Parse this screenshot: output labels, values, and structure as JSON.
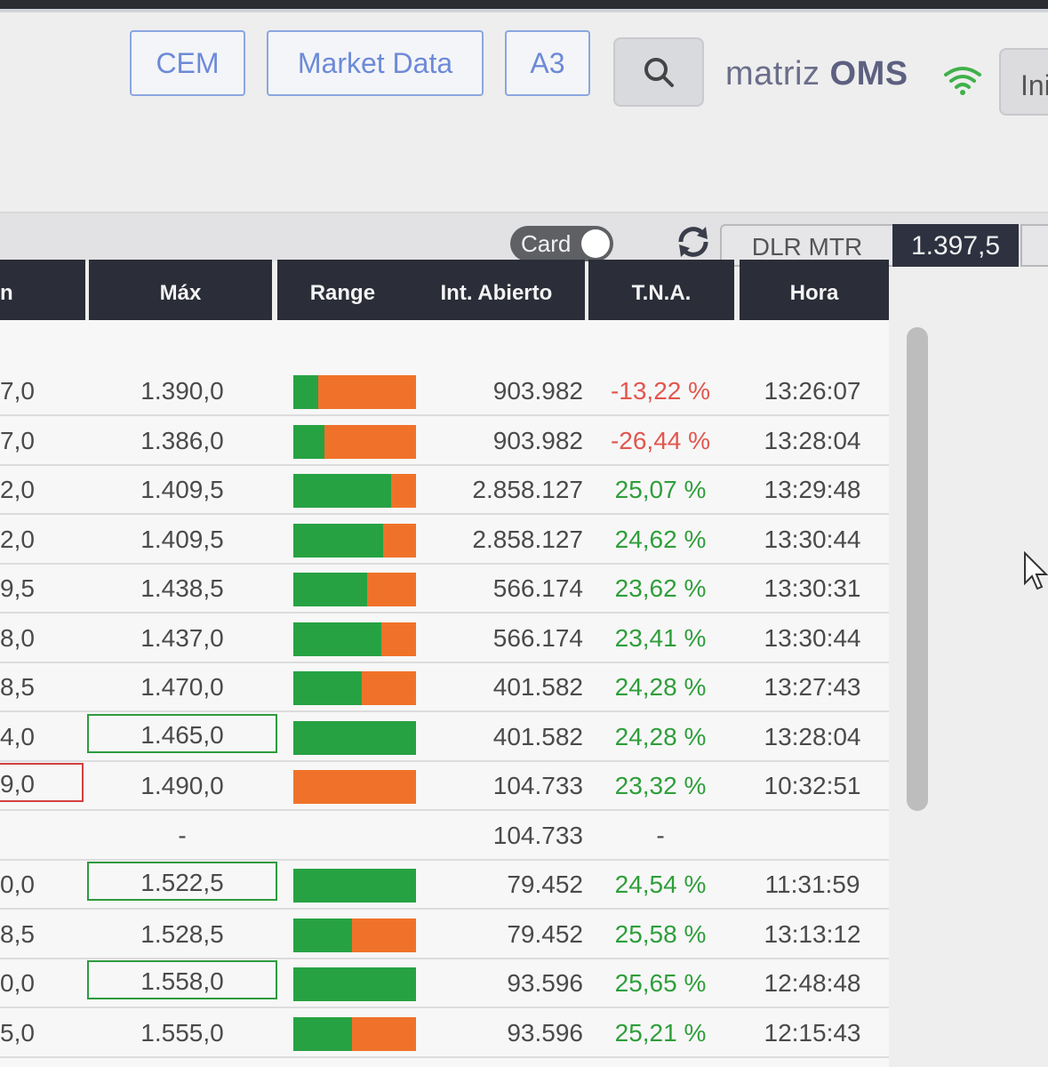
{
  "nav": {
    "cem_label": "CEM",
    "market_data_label": "Market Data",
    "a3_label": "A3",
    "search_icon": "search-icon",
    "brand_prefix": "matriz",
    "brand_suffix": "OMS",
    "wifi_icon": "wifi-icon",
    "partial_button_label": "Ini"
  },
  "toolbar": {
    "card_toggle_label": "Card",
    "refresh_icon": "refresh-icon",
    "dlr_label": "DLR MTR",
    "dlr_value": "1.397,5"
  },
  "table": {
    "headers": {
      "prev": "n",
      "max": "Máx",
      "range": "Range",
      "int_abierto": "Int. Abierto",
      "tna": "T.N.A.",
      "hora": "Hora"
    },
    "rows": [
      {
        "prev": "7,0",
        "max": "1.390,0",
        "range_green_fraction": 0.2,
        "int_abierto": "903.982",
        "tna": "-13,22 %",
        "tna_sign": "neg",
        "hora": "13:26:07",
        "highlight": ""
      },
      {
        "prev": "7,0",
        "max": "1.386,0",
        "range_green_fraction": 0.25,
        "int_abierto": "903.982",
        "tna": "-26,44 %",
        "tna_sign": "neg",
        "hora": "13:28:04",
        "highlight": ""
      },
      {
        "prev": "2,0",
        "max": "1.409,5",
        "range_green_fraction": 0.8,
        "int_abierto": "2.858.127",
        "tna": "25,07 %",
        "tna_sign": "pos",
        "hora": "13:29:48",
        "highlight": ""
      },
      {
        "prev": "2,0",
        "max": "1.409,5",
        "range_green_fraction": 0.73,
        "int_abierto": "2.858.127",
        "tna": "24,62 %",
        "tna_sign": "pos",
        "hora": "13:30:44",
        "highlight": ""
      },
      {
        "prev": "9,5",
        "max": "1.438,5",
        "range_green_fraction": 0.6,
        "int_abierto": "566.174",
        "tna": "23,62 %",
        "tna_sign": "pos",
        "hora": "13:30:31",
        "highlight": ""
      },
      {
        "prev": "8,0",
        "max": "1.437,0",
        "range_green_fraction": 0.72,
        "int_abierto": "566.174",
        "tna": "23,41 %",
        "tna_sign": "pos",
        "hora": "13:30:44",
        "highlight": ""
      },
      {
        "prev": "8,5",
        "max": "1.470,0",
        "range_green_fraction": 0.56,
        "int_abierto": "401.582",
        "tna": "24,28 %",
        "tna_sign": "pos",
        "hora": "13:27:43",
        "highlight": ""
      },
      {
        "prev": "4,0",
        "max": "1.465,0",
        "range_green_fraction": 1.0,
        "int_abierto": "401.582",
        "tna": "24,28 %",
        "tna_sign": "pos",
        "hora": "13:28:04",
        "highlight": "max-green"
      },
      {
        "prev": "9,0",
        "max": "1.490,0",
        "range_green_fraction": 0.0,
        "int_abierto": "104.733",
        "tna": "23,32 %",
        "tna_sign": "pos",
        "hora": "10:32:51",
        "highlight": "prev-red"
      },
      {
        "prev": "",
        "max": "-",
        "range_green_fraction": null,
        "int_abierto": "104.733",
        "tna": "-",
        "tna_sign": "none",
        "hora": "",
        "highlight": ""
      },
      {
        "prev": "0,0",
        "max": "1.522,5",
        "range_green_fraction": 1.0,
        "int_abierto": "79.452",
        "tna": "24,54 %",
        "tna_sign": "pos",
        "hora": "11:31:59",
        "highlight": "max-green"
      },
      {
        "prev": "8,5",
        "max": "1.528,5",
        "range_green_fraction": 0.48,
        "int_abierto": "79.452",
        "tna": "25,58 %",
        "tna_sign": "pos",
        "hora": "13:13:12",
        "highlight": ""
      },
      {
        "prev": "0,0",
        "max": "1.558,0",
        "range_green_fraction": 1.0,
        "int_abierto": "93.596",
        "tna": "25,65 %",
        "tna_sign": "pos",
        "hora": "12:48:48",
        "highlight": "max-green"
      },
      {
        "prev": "5,0",
        "max": "1.555,0",
        "range_green_fraction": 0.48,
        "int_abierto": "93.596",
        "tna": "25,21 %",
        "tna_sign": "pos",
        "hora": "12:15:43",
        "highlight": ""
      }
    ]
  },
  "colors": {
    "range_green": "#27a243",
    "range_orange": "#f0722a",
    "tna_negative": "#e2564f",
    "tna_positive": "#2f9e3b",
    "header_bg": "#2b2d38",
    "nav_blue": "#6c8ad8"
  }
}
